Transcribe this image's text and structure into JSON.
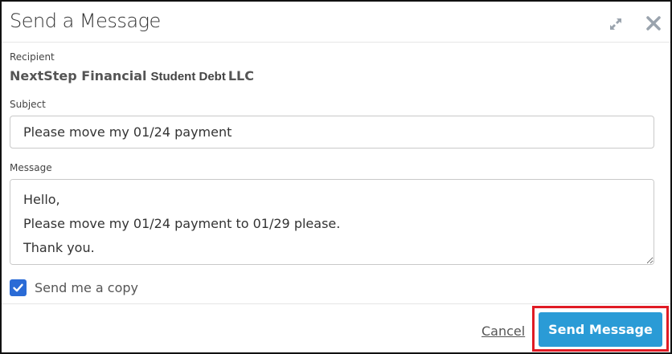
{
  "dialog": {
    "title": "Send a Message"
  },
  "recipient": {
    "label": "Recipient",
    "name_part1": "NextStep Financial",
    "name_part2": "Student Debt",
    "name_part3": "LLC"
  },
  "subject": {
    "label": "Subject",
    "value": "Please move my 01/24 payment"
  },
  "message": {
    "label": "Message",
    "value": "Hello,\nPlease move my 01/24 payment to 01/29 please.\nThank you."
  },
  "copy_option": {
    "label": "Send me a copy",
    "checked": true
  },
  "footer": {
    "cancel_label": "Cancel",
    "send_label": "Send Message"
  },
  "colors": {
    "accent": "#2a9bd6",
    "checkbox": "#2a6bd6",
    "highlight": "#e01b24"
  },
  "icons": {
    "expand": "expand-icon",
    "close": "close-icon",
    "check": "check-icon"
  }
}
